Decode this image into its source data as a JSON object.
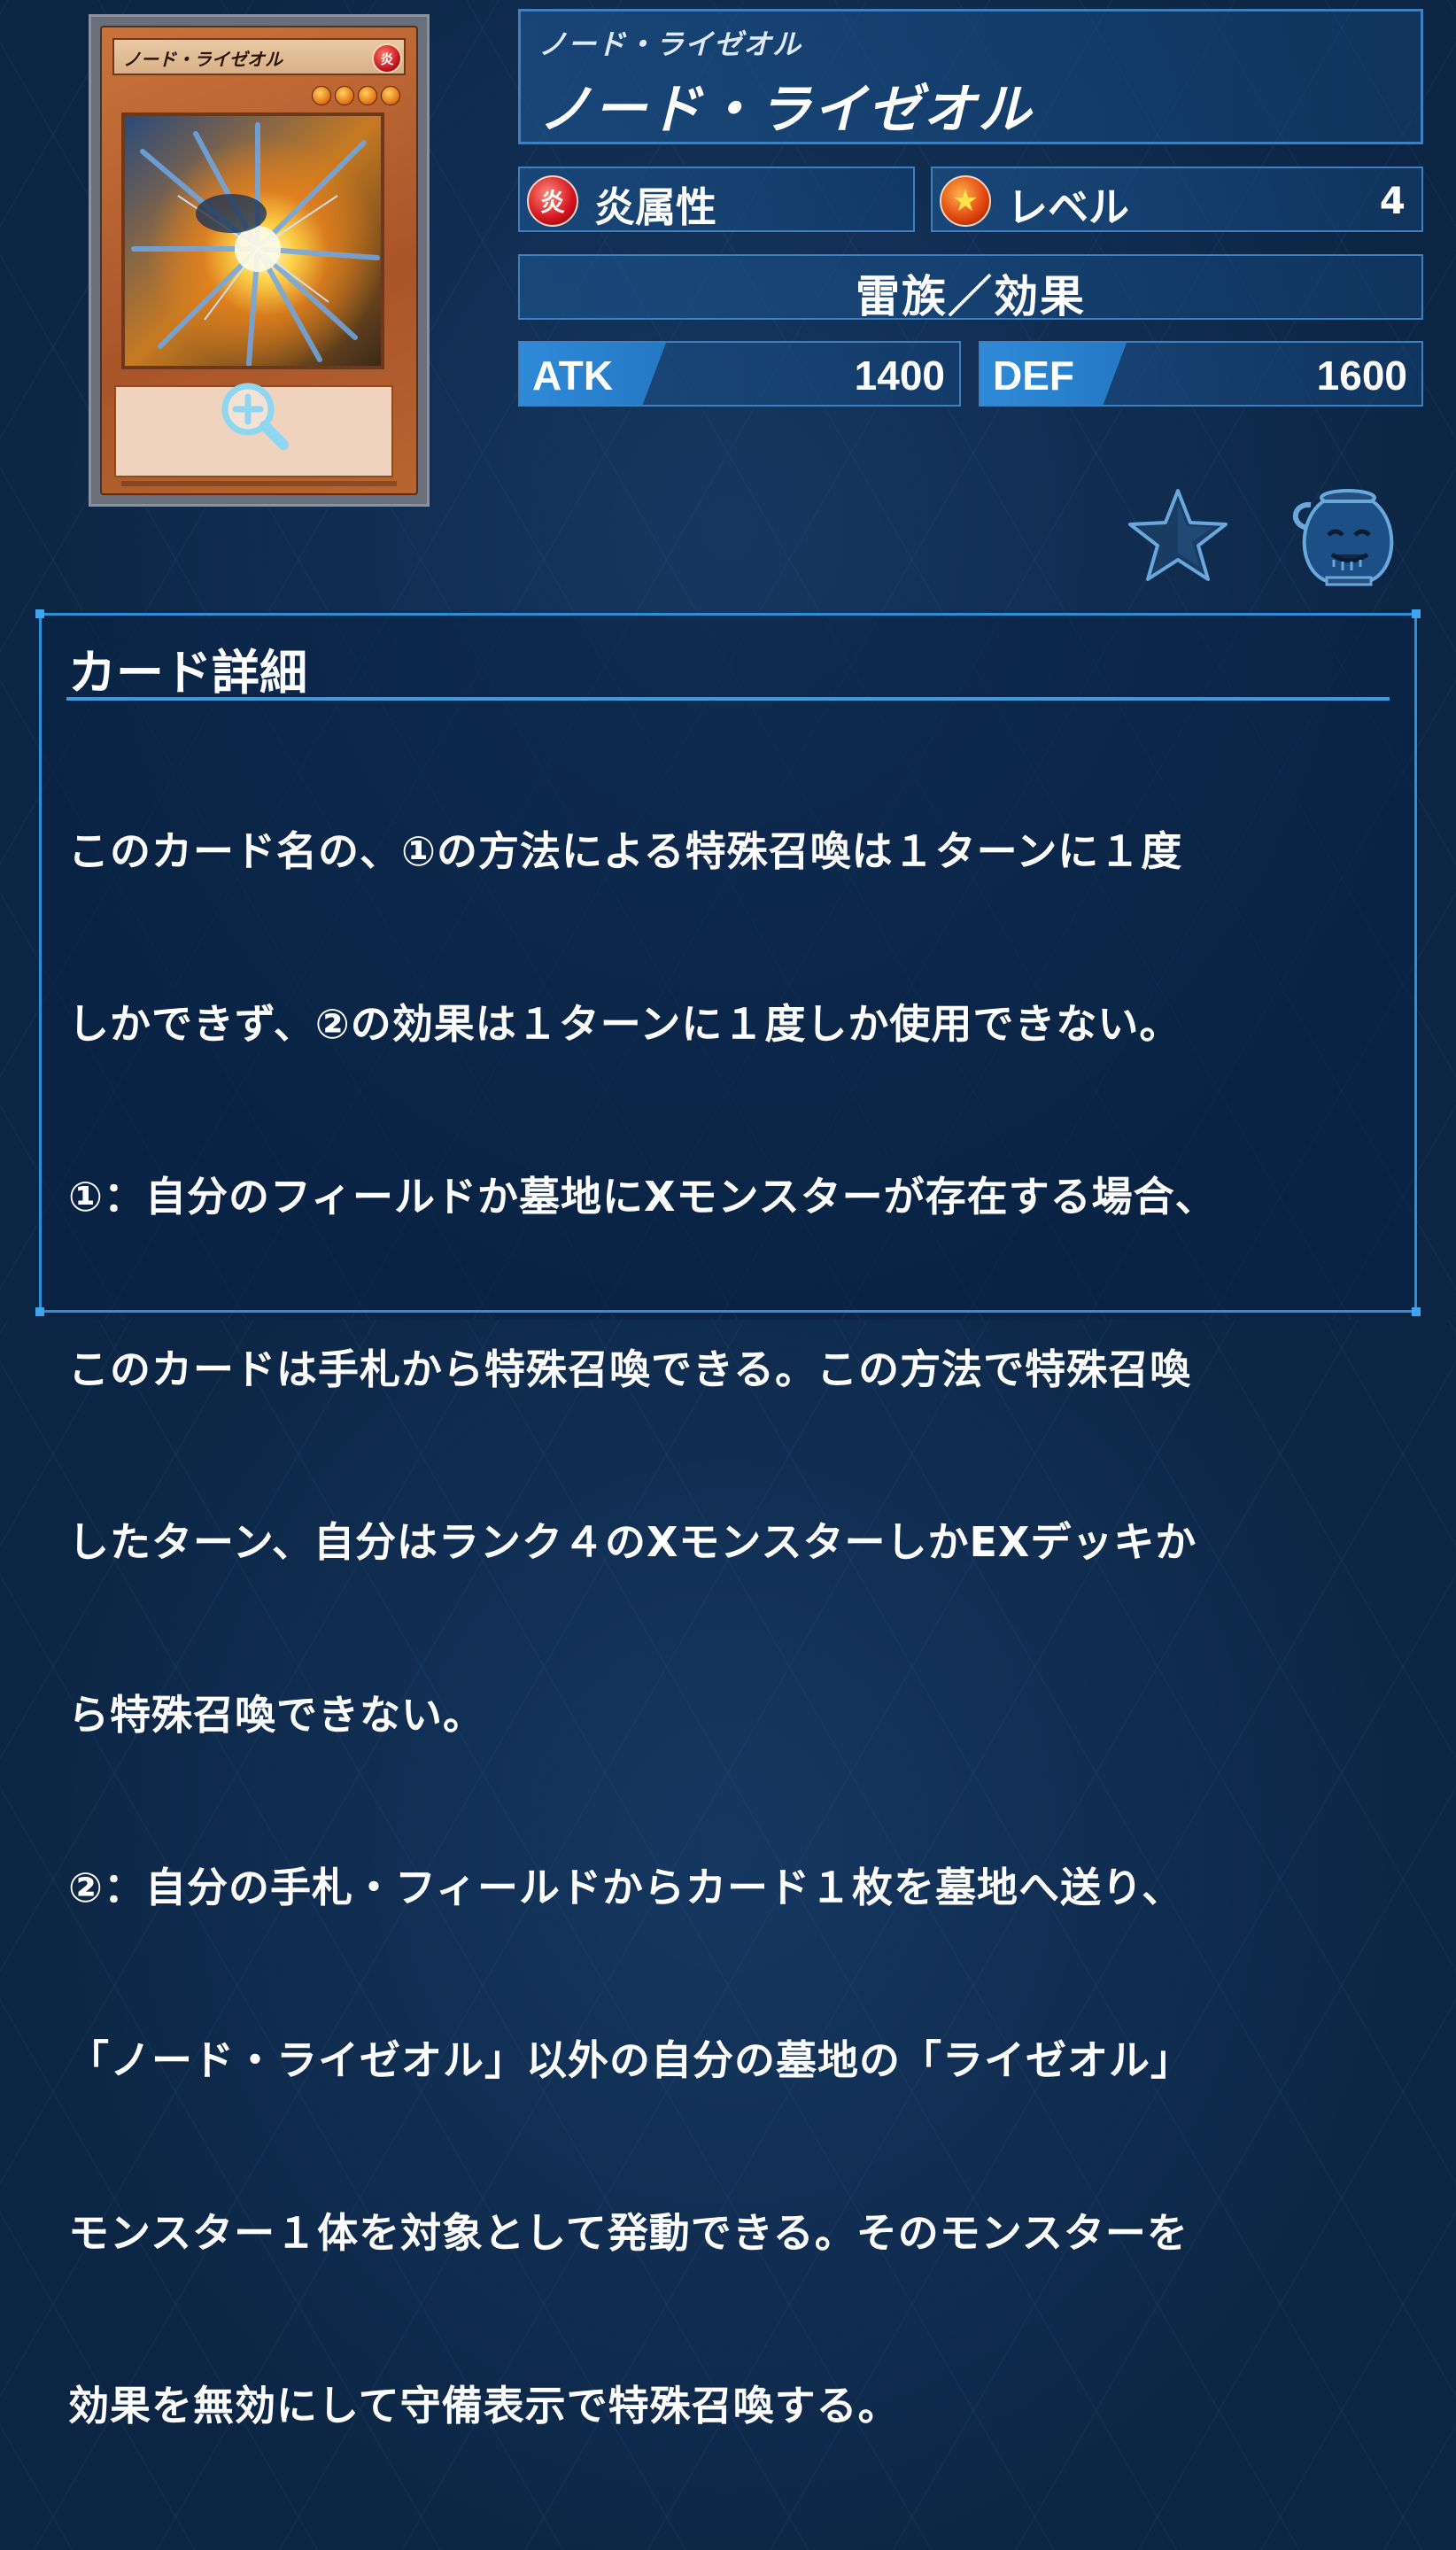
{
  "card": {
    "ruby": "ノード・ライゼオル",
    "name": "ノード・ライゼオル",
    "card_image_name": "ノード・ライゼオル",
    "card_image_attribute": "炎"
  },
  "attribute": {
    "icon_text": "炎",
    "label": "炎属性"
  },
  "level": {
    "label": "レベル",
    "value": "4",
    "star_count": 4
  },
  "type_line": "雷族／効果",
  "stats": {
    "atk_label": "ATK",
    "atk_value": "1400",
    "def_label": "DEF",
    "def_value": "1600"
  },
  "actions": {
    "favorite": "star-icon",
    "pot": "pot-icon"
  },
  "detail": {
    "title": "カード詳細",
    "lines": [
      "このカード名の、①の方法による特殊召喚は１ターンに１度",
      "しかできず、②の効果は１ターンに１度しか使用できない。",
      "①：自分のフィールドか墓地にXモンスターが存在する場合、",
      "このカードは手札から特殊召喚できる。この方法で特殊召喚",
      "したターン、自分はランク４のXモンスターしかEXデッキか",
      "ら特殊召喚できない。",
      "②：自分の手札・フィールドからカード１枚を墓地へ送り、",
      "「ノード・ライゼオル」以外の自分の墓地の「ライゼオル」",
      "モンスター１体を対象として発動できる。そのモンスターを",
      "効果を無効にして守備表示で特殊召喚する。"
    ]
  },
  "colors": {
    "background": "#0c2544",
    "panel_border": "#3e7fbf",
    "accent": "#2f8ad8",
    "fire": "#d3121e"
  }
}
